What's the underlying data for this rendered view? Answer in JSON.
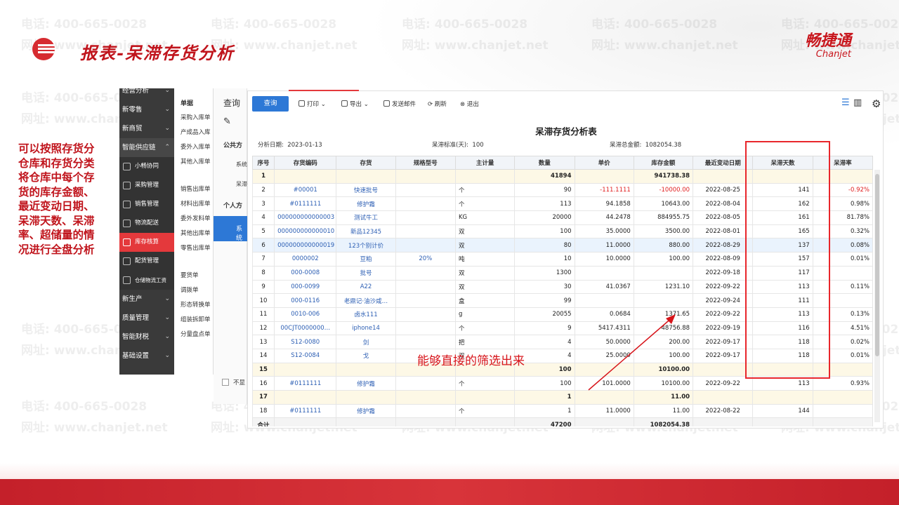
{
  "slide": {
    "title": "报表-呆滞存货分析",
    "brand_cn": "畅捷通",
    "brand_en": "Chanjet",
    "description": "可以按照存货分仓库和存货分类将仓库中每个存货的库存金额、最近变动日期、呆滞天数、呆滞率、超储量的情况进行全盘分析",
    "annotation": "能够直接的筛选出来",
    "watermark_phone": "电话: 400-665-0028",
    "watermark_url": "网址: www.chanjet.net"
  },
  "menu": {
    "items": [
      {
        "label": "经营分析",
        "arrow": "⌄"
      },
      {
        "label": "新零售",
        "arrow": "⌄"
      },
      {
        "label": "新商贸",
        "arrow": "⌄"
      },
      {
        "label": "智能供应链",
        "arrow": "⌃"
      },
      {
        "label": "小畅协同"
      },
      {
        "label": "采购管理"
      },
      {
        "label": "销售管理"
      },
      {
        "label": "物流配送"
      },
      {
        "label": "库存核算"
      },
      {
        "label": "配货管理"
      },
      {
        "label": "仓储物流工资"
      },
      {
        "label": "新生产",
        "arrow": "⌄"
      },
      {
        "label": "质量管理",
        "arrow": "⌄"
      },
      {
        "label": "智能财税",
        "arrow": "⌄"
      },
      {
        "label": "基础设置",
        "arrow": "⌄"
      }
    ]
  },
  "submenu": {
    "head": "单据",
    "items": [
      "采购入库单",
      "产成品入库",
      "委外入库单",
      "其他入库单",
      "销售出库单",
      "材料出库单",
      "委外发料单",
      "其他出库单",
      "零售出库单",
      "要货单",
      "调拨单",
      "形态转换单",
      "组装拆卸单",
      "分量盘点单"
    ]
  },
  "query_panel": {
    "title": "查询",
    "public": "公共方",
    "sys1": "系统",
    "stale": "呆滞",
    "personal": "个人方",
    "sys2": "系统",
    "hide": "不显"
  },
  "toolbar": {
    "query": "查询",
    "print": "打印",
    "export": "导出",
    "email": "发送邮件",
    "refresh": "刷新",
    "exit": "退出"
  },
  "report": {
    "title": "呆滞存货分析表",
    "date_label": "分析日期:",
    "date_value": "2023-01-13",
    "standard_label": "呆滞标准(天):",
    "standard_value": "100",
    "total_label": "呆滞总金额:",
    "total_value": "1082054.38"
  },
  "table": {
    "headers": [
      "序号",
      "存货编码",
      "存货",
      "规格型号",
      "主计量",
      "数量",
      "单价",
      "库存金额",
      "最近变动日期",
      "呆滞天数",
      "呆滞率"
    ],
    "rows": [
      {
        "type": "sub",
        "cells": [
          "1",
          "",
          "",
          "",
          "",
          "41894",
          "",
          "941738.38",
          "",
          "",
          ""
        ]
      },
      {
        "type": "data",
        "cells": [
          "2",
          "#00001",
          "快速批号",
          "",
          "个",
          "90",
          "-111.1111",
          "-10000.00",
          "2022-08-25",
          "141",
          "-0.92%"
        ]
      },
      {
        "type": "data",
        "cells": [
          "3",
          "#0111111",
          "修护霜",
          "",
          "个",
          "113",
          "94.1858",
          "10643.00",
          "2022-08-04",
          "162",
          "0.98%"
        ]
      },
      {
        "type": "data",
        "cells": [
          "4",
          "000000000000003",
          "测试牛工",
          "",
          "KG",
          "20000",
          "44.2478",
          "884955.75",
          "2022-08-05",
          "161",
          "81.78%"
        ]
      },
      {
        "type": "data",
        "cells": [
          "5",
          "000000000000010",
          "新品12345",
          "",
          "双",
          "100",
          "35.0000",
          "3500.00",
          "2022-08-01",
          "165",
          "0.32%"
        ]
      },
      {
        "type": "hl",
        "cells": [
          "6",
          "000000000000019",
          "123个别计价",
          "",
          "双",
          "80",
          "11.0000",
          "880.00",
          "2022-08-29",
          "137",
          "0.08%"
        ]
      },
      {
        "type": "data",
        "cells": [
          "7",
          "0000002",
          "豆粕",
          "20%",
          "吨",
          "10",
          "10.0000",
          "100.00",
          "2022-08-09",
          "157",
          "0.01%"
        ]
      },
      {
        "type": "data",
        "cells": [
          "8",
          "000-0008",
          "批号",
          "",
          "双",
          "1300",
          "",
          "",
          "2022-09-18",
          "117",
          ""
        ]
      },
      {
        "type": "data",
        "cells": [
          "9",
          "000-0099",
          "A22",
          "",
          "双",
          "30",
          "41.0367",
          "1231.10",
          "2022-09-22",
          "113",
          "0.11%"
        ]
      },
      {
        "type": "data",
        "cells": [
          "10",
          "000-0116",
          "老鼎记·油沙咸…",
          "",
          "盒",
          "99",
          "",
          "",
          "2022-09-24",
          "111",
          ""
        ]
      },
      {
        "type": "data",
        "cells": [
          "11",
          "0010-006",
          "卤水111",
          "",
          "g",
          "20055",
          "0.0684",
          "1371.65",
          "2022-09-22",
          "113",
          "0.13%"
        ]
      },
      {
        "type": "data",
        "cells": [
          "12",
          "00CJT0000000…",
          "iphone14",
          "",
          "个",
          "9",
          "5417.4311",
          "48756.88",
          "2022-09-19",
          "116",
          "4.51%"
        ]
      },
      {
        "type": "data",
        "cells": [
          "13",
          "S12-0080",
          "剑",
          "",
          "把",
          "4",
          "50.0000",
          "200.00",
          "2022-09-17",
          "118",
          "0.02%"
        ]
      },
      {
        "type": "data",
        "cells": [
          "14",
          "S12-0084",
          "戈",
          "",
          "双",
          "4",
          "25.0000",
          "100.00",
          "2022-09-17",
          "118",
          "0.01%"
        ]
      },
      {
        "type": "sub",
        "cells": [
          "15",
          "",
          "",
          "",
          "",
          "100",
          "",
          "10100.00",
          "",
          "",
          ""
        ]
      },
      {
        "type": "data",
        "cells": [
          "16",
          "#0111111",
          "修护霜",
          "",
          "个",
          "100",
          "101.0000",
          "10100.00",
          "2022-09-22",
          "113",
          "0.93%"
        ]
      },
      {
        "type": "sub",
        "cells": [
          "17",
          "",
          "",
          "",
          "",
          "1",
          "",
          "11.00",
          "",
          "",
          ""
        ]
      },
      {
        "type": "data",
        "cells": [
          "18",
          "#0111111",
          "修护霜",
          "",
          "个",
          "1",
          "11.0000",
          "11.00",
          "2022-08-22",
          "144",
          ""
        ]
      },
      {
        "type": "total",
        "cells": [
          "合计",
          "",
          "",
          "",
          "",
          "47200",
          "",
          "1082054.38",
          "",
          "",
          ""
        ]
      }
    ]
  },
  "colors": {
    "accent": "#e4393c",
    "primary": "#2d78d6",
    "brand_red": "#c8161d"
  }
}
